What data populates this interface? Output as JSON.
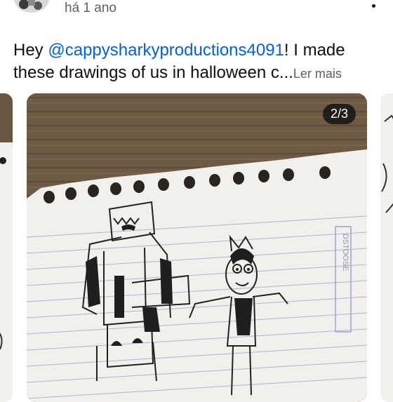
{
  "post": {
    "timestamp": "há 1 ano",
    "text_intro": "Hey ",
    "mention": "@cappysharkyproductions4091",
    "text_after_mention": "! I made",
    "text_line2": "these drawings of us in halloween c...",
    "read_more": "Ler mais"
  },
  "carousel": {
    "counter": "2/3",
    "image_stamp": "DSTOOSE"
  },
  "colors": {
    "mention": "#065fd4",
    "secondary_text": "#606060",
    "counter_bg": "#0f0f0f"
  },
  "icons": {
    "more": "more-vert-icon"
  }
}
